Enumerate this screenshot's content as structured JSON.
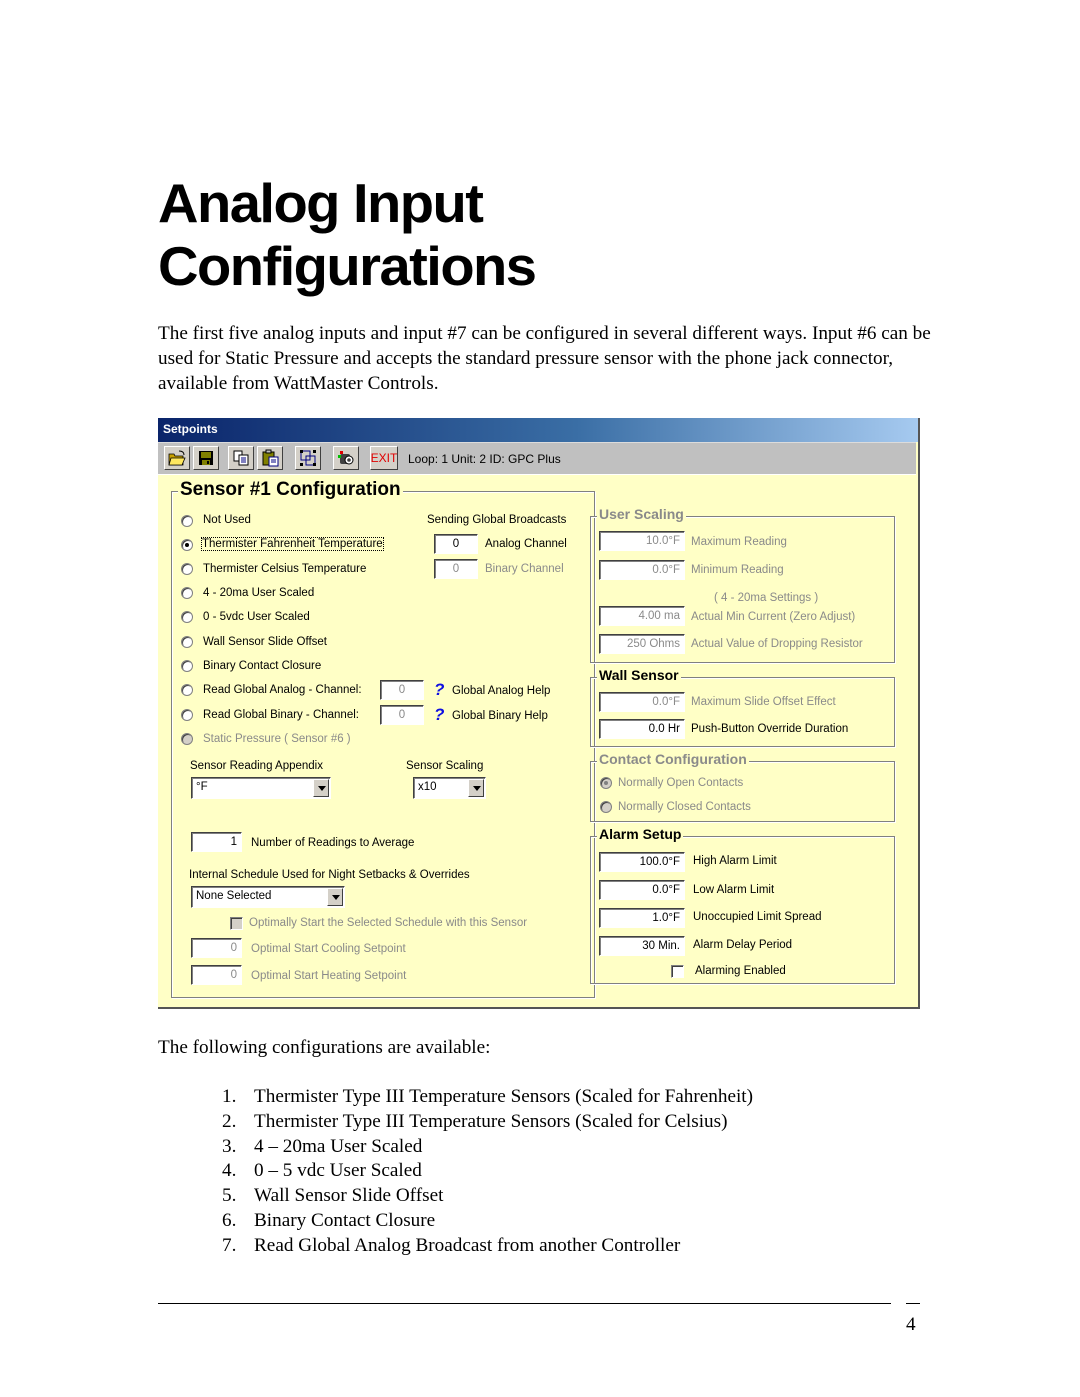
{
  "document": {
    "title_line1": "Analog Input",
    "title_line2": "Configurations",
    "intro": "The first five analog inputs and input #7 can be configured in several different ways. Input #6 can be used for Static Pressure and accepts the standard pressure sensor with the phone jack connector, available from WattMaster Controls.",
    "following": "The following configurations are available:",
    "list": [
      {
        "num": "1.",
        "text": "Thermister Type III Temperature Sensors (Scaled for Fahrenheit)"
      },
      {
        "num": "2.",
        "text": "Thermister Type III Temperature Sensors (Scaled for Celsius)"
      },
      {
        "num": "3.",
        "text": "4 – 20ma User Scaled"
      },
      {
        "num": "4.",
        "text": "0 – 5 vdc User Scaled"
      },
      {
        "num": "5.",
        "text": "Wall Sensor Slide Offset"
      },
      {
        "num": "6.",
        "text": "Binary Contact Closure"
      },
      {
        "num": "7.",
        "text": "Read Global Analog Broadcast from another Controller"
      }
    ],
    "page_number": "4"
  },
  "window": {
    "title": "Setpoints",
    "toolbar": {
      "buttons": [
        "open-icon",
        "save-icon",
        "copy-icon",
        "paste-icon",
        "resize-icon",
        "camera-icon"
      ],
      "exit_label": "EXIT",
      "info": "Loop: 1  Unit: 2  ID: GPC Plus"
    },
    "sensor_config": {
      "legend": "Sensor #1 Configuration",
      "options": [
        {
          "label": "Not Used",
          "selected": false,
          "enabled": true
        },
        {
          "label": "Thermister Fahrenheit Temperature",
          "selected": true,
          "enabled": true
        },
        {
          "label": "Thermister Celsius Temperature",
          "selected": false,
          "enabled": true
        },
        {
          "label": "4 - 20ma User Scaled",
          "selected": false,
          "enabled": true
        },
        {
          "label": "0 - 5vdc User Scaled",
          "selected": false,
          "enabled": true
        },
        {
          "label": "Wall Sensor Slide Offset",
          "selected": false,
          "enabled": true
        },
        {
          "label": "Binary Contact Closure",
          "selected": false,
          "enabled": true
        },
        {
          "label": "Read Global Analog  - Channel:",
          "selected": false,
          "enabled": true
        },
        {
          "label": "Read Global Binary   - Channel:",
          "selected": false,
          "enabled": true
        },
        {
          "label": "Static Pressure ( Sensor #6 )",
          "selected": false,
          "enabled": false
        }
      ],
      "global_analog_channel": "0",
      "global_binary_channel": "0",
      "global_analog_help": "Global Analog Help",
      "global_binary_help": "Global Binary Help",
      "help_glyph": "?",
      "sending_broadcasts_label": "Sending Global Broadcasts",
      "analog_channel_value": "0",
      "analog_channel_label": "Analog Channel",
      "binary_channel_value": "0",
      "binary_channel_label": "Binary Channel",
      "appendix_label": "Sensor Reading Appendix",
      "appendix_value": "°F",
      "scaling_label": "Sensor Scaling",
      "scaling_value": "x10",
      "readings_value": "1",
      "readings_label": "Number of Readings to Average",
      "schedule_label": "Internal Schedule Used for Night Setbacks & Overrides",
      "schedule_value": "None Selected",
      "optimal_start_label": "Optimally Start the Selected Schedule with this Sensor",
      "optimal_start_checked": false,
      "cooling_value": "0",
      "cooling_label": "Optimal Start Cooling Setpoint",
      "heating_value": "0",
      "heating_label": "Optimal Start Heating Setpoint"
    },
    "user_scaling": {
      "legend": "User Scaling",
      "max_value": "10.0°F",
      "max_label": "Maximum Reading",
      "min_value": "0.0°F",
      "min_label": "Minimum Reading",
      "settings_note": "( 4 - 20ma Settings )",
      "min_current_value": "4.00 ma",
      "min_current_label": "Actual Min Current (Zero Adjust)",
      "resistor_value": "250 Ohms",
      "resistor_label": "Actual Value of Dropping Resistor"
    },
    "wall_sensor": {
      "legend": "Wall Sensor",
      "slide_value": "0.0°F",
      "slide_label": "Maximum Slide Offset Effect",
      "override_value": "0.0 Hr",
      "override_label": "Push-Button Override Duration"
    },
    "contact_config": {
      "legend": "Contact Configuration",
      "open_label": "Normally Open Contacts",
      "open_selected": true,
      "closed_label": "Normally Closed Contacts",
      "closed_selected": false
    },
    "alarm_setup": {
      "legend": "Alarm Setup",
      "high_value": "100.0°F",
      "high_label": "High Alarm Limit",
      "low_value": "0.0°F",
      "low_label": "Low Alarm Limit",
      "spread_value": "1.0°F",
      "spread_label": "Unoccupied Limit Spread",
      "delay_value": "30 Min.",
      "delay_label": "Alarm Delay Period",
      "enabled_label": "Alarming Enabled",
      "enabled_checked": false
    }
  }
}
